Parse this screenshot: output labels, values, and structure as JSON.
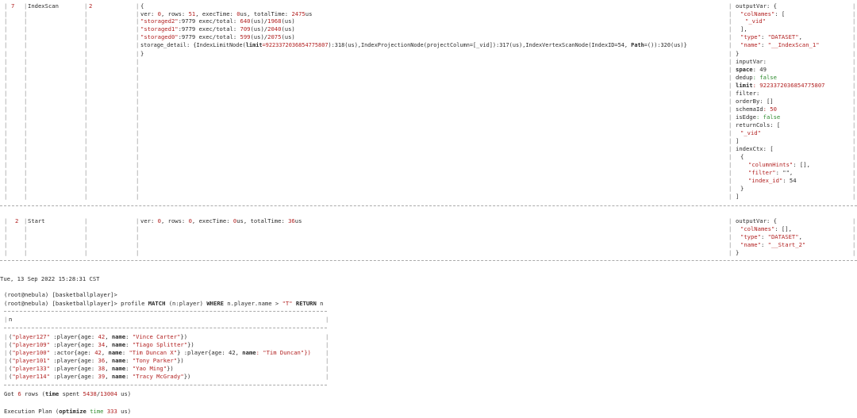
{
  "plan": {
    "row7": {
      "id": "7",
      "name": "IndexScan",
      "deps": "2",
      "profile": {
        "open": "{",
        "stats_prefix": "ver: ",
        "ver": "0",
        "rows_label": ", rows: ",
        "rows": "51",
        "exec_label": ", execTime: ",
        "exec": "0",
        "exec_unit": "us",
        "total_label": ", totalTime: ",
        "total": "2475",
        "total_unit": "us",
        "storaged": [
          {
            "name": "\"storaged2\"",
            "rest": ":9779 exec/total: ",
            "exec": "640",
            "sep": "(us)/",
            "total": "1968",
            "end": "(us)"
          },
          {
            "name": "\"storaged1\"",
            "rest": ":9779 exec/total: ",
            "exec": "709",
            "sep": "(us)/",
            "total": "2040",
            "end": "(us)"
          },
          {
            "name": "\"storaged0\"",
            "rest": ":9779 exec/total: ",
            "exec": "599",
            "sep": "(us)/",
            "total": "2075",
            "end": "(us)"
          }
        ],
        "detail_a": "storage_detail: {IndexLimitNode(",
        "detail_limit_key": "limit",
        "detail_limit_val": "=9223372036854775807",
        "detail_b": "):318(us),IndexProjectionNode(projectColumn=[_vid]):317(us),IndexVertexScanNode(IndexID=54, ",
        "detail_path_key": "Path",
        "detail_c": "=()):320(us)}",
        "close": "}"
      },
      "desc": {
        "l1": "outputVar: {",
        "l2_key": "\"colNames\"",
        "l2_rest": ": [",
        "l3": "\"_vid\"",
        "l4": "],",
        "l5_key": "\"type\"",
        "l5_sep": ": ",
        "l5_val": "\"DATASET\"",
        "l5_end": ",",
        "l6_key": "\"name\"",
        "l6_sep": ": ",
        "l6_val": "\"__IndexScan_1\"",
        "l7": "}",
        "l8": "inputVar:",
        "l9_key": "space",
        "l9_val": ": 49",
        "l10_key": "dedup",
        "l10_val": ": false",
        "l11_key": "limit",
        "l11_val": ": 9223372036854775807",
        "l12": "filter:",
        "l13": "orderBy: []",
        "l14_key": "schemaId",
        "l14_val": ": 50",
        "l15_key": "isEdge",
        "l15_val": ": false",
        "l16": "returnCols: [",
        "l17": "\"_vid\"",
        "l18": "]",
        "l19": "indexCtx: [",
        "l20": "{",
        "l21_key": "\"columnHints\"",
        "l21_val": ": [],",
        "l22_key": "\"filter\"",
        "l22_val": ": \"\",",
        "l23_key": "\"index_id\"",
        "l23_val": ": 54",
        "l24": "}",
        "l25": "]"
      }
    },
    "row2": {
      "id": "2",
      "name": "Start",
      "profile": {
        "stats_prefix": "ver: ",
        "ver": "0",
        "rows_label": ", rows: ",
        "rows": "0",
        "exec_label": ", execTime: ",
        "exec": "0",
        "exec_unit": "us",
        "total_label": ", totalTime: ",
        "total": "36",
        "total_unit": "us"
      },
      "desc": {
        "l1": "outputVar: {",
        "l2_key": "\"colNames\"",
        "l2_rest": ": [],",
        "l3_key": "\"type\"",
        "l3_sep": ": ",
        "l3_val": "\"DATASET\"",
        "l3_end": ",",
        "l4_key": "\"name\"",
        "l4_sep": ": ",
        "l4_val": "\"__Start_2\"",
        "l5": "}"
      }
    }
  },
  "timestamp": "Tue, 13 Sep 2022 15:28:31 CST",
  "prompt1": "(root@nebula) [basketballplayer]>",
  "prompt2": "(root@nebula) [basketballplayer]>",
  "query": {
    "p1": " profile ",
    "kw1": "MATCH",
    "p2": " (n:player) ",
    "kw2": "WHERE",
    "p3": " n.player.name > ",
    "str": "\"T\"",
    "p4": " ",
    "kw3": "RETURN",
    "p5": " n"
  },
  "result": {
    "header": "n",
    "rows": [
      {
        "a": "(",
        "vid": "\"player127\"",
        "b": " :player{age: ",
        "age": "42",
        "c": ", ",
        "nk": "name",
        "d": ": ",
        "name": "\"Vince Carter\"",
        "e": "})",
        "extra": ""
      },
      {
        "a": "(",
        "vid": "\"player109\"",
        "b": " :player{age: ",
        "age": "34",
        "c": ", ",
        "nk": "name",
        "d": ": ",
        "name": "\"Tiago Splitter\"",
        "e": "})",
        "extra": ""
      },
      {
        "a": "(",
        "vid": "\"player100\"",
        "b": " :actor{age: ",
        "age": "42",
        "c": ", ",
        "nk": "name",
        "d": ": ",
        "name": "\"Tim Duncan X\"",
        "e": "} :player{age: 42, ",
        "extra": "name"
      },
      {
        "a": "(",
        "vid": "\"player101\"",
        "b": " :player{age: ",
        "age": "36",
        "c": ", ",
        "nk": "name",
        "d": ": ",
        "name": "\"Tony Parker\"",
        "e": "})",
        "extra": ""
      },
      {
        "a": "(",
        "vid": "\"player133\"",
        "b": " :player{age: ",
        "age": "38",
        "c": ", ",
        "nk": "name",
        "d": ": ",
        "name": "\"Yao Ming\"",
        "e": "})",
        "extra": ""
      },
      {
        "a": "(",
        "vid": "\"player114\"",
        "b": " :player{age: ",
        "age": "39",
        "c": ", ",
        "nk": "name",
        "d": ": ",
        "name": "\"Tracy McGrady\"",
        "e": "})",
        "extra": ""
      }
    ],
    "row3_tail": ": \"Tim Duncan\"})"
  },
  "summary": {
    "got": "Got ",
    "n": "6",
    "rows": " rows (",
    "time_kw": "time",
    "spent": " spent ",
    "t1": "5438",
    "slash": "/",
    "t2": "13004",
    "us": " us)"
  },
  "exec_plan": {
    "label": "Execution Plan (",
    "kw": "optimize",
    "mid": " ",
    "time_kw": "time",
    "val": " 333",
    "end": " us)"
  },
  "colors": {
    "red": "#b22222",
    "green": "#2e8b2e",
    "text": "#2b2b2b"
  }
}
